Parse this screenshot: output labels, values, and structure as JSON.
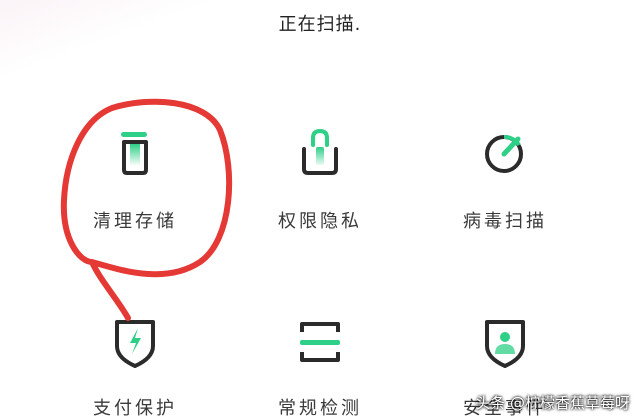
{
  "status": "正在扫描.",
  "features": [
    {
      "label": "清理存储",
      "icon": "trash-icon"
    },
    {
      "label": "权限隐私",
      "icon": "lock-icon"
    },
    {
      "label": "病毒扫描",
      "icon": "scan-icon"
    },
    {
      "label": "支付保护",
      "icon": "shield-bolt-icon"
    },
    {
      "label": "常规检测",
      "icon": "scan-frame-icon"
    },
    {
      "label": "安全事件",
      "icon": "shield-user-icon"
    }
  ],
  "watermark": "头条 @柠檬香蕉草莓呀",
  "colors": {
    "accent": "#2ecf87",
    "icon_dark": "#2b2b2b",
    "annotation": "#e53935"
  }
}
